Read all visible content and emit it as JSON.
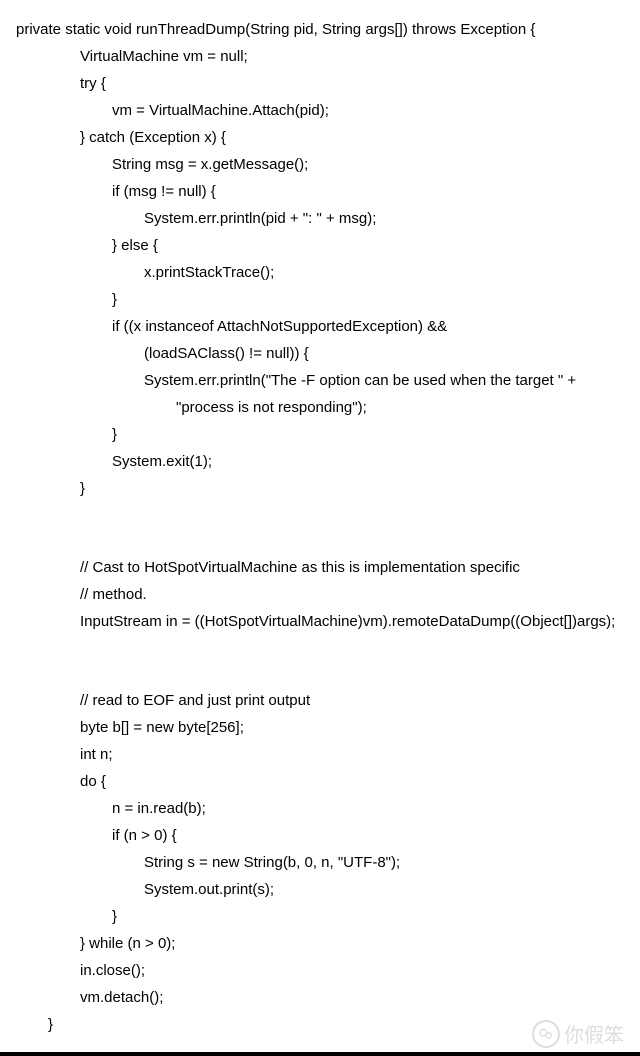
{
  "code": {
    "lines": [
      {
        "indent": 0,
        "text": "private static void runThreadDump(String pid, String args[]) throws Exception {"
      },
      {
        "indent": 2,
        "text": "VirtualMachine vm = null;"
      },
      {
        "indent": 2,
        "text": "try {"
      },
      {
        "indent": 3,
        "text": "vm = VirtualMachine.Attach(pid);"
      },
      {
        "indent": 2,
        "text": "} catch (Exception x) {"
      },
      {
        "indent": 3,
        "text": "String msg = x.getMessage();"
      },
      {
        "indent": 3,
        "text": "if (msg != null) {"
      },
      {
        "indent": 4,
        "text": "System.err.println(pid + \": \" + msg);"
      },
      {
        "indent": 3,
        "text": "} else {"
      },
      {
        "indent": 4,
        "text": "x.printStackTrace();"
      },
      {
        "indent": 3,
        "text": "}"
      },
      {
        "indent": 3,
        "text": "if ((x instanceof AttachNotSupportedException) &&"
      },
      {
        "indent": 4,
        "text": "(loadSAClass() != null)) {"
      },
      {
        "indent": 4,
        "text": "System.err.println(\"The -F option can be used when the target \" +"
      },
      {
        "indent": 5,
        "text": "\"process is not responding\");"
      },
      {
        "indent": 3,
        "text": "}"
      },
      {
        "indent": 3,
        "text": "System.exit(1);"
      },
      {
        "indent": 2,
        "text": "}"
      },
      {
        "indent": 0,
        "text": ""
      },
      {
        "indent": 0,
        "text": ""
      },
      {
        "indent": 2,
        "text": "// Cast to HotSpotVirtualMachine as this is implementation specific"
      },
      {
        "indent": 2,
        "text": "// method."
      },
      {
        "indent": 2,
        "text": "InputStream in = ((HotSpotVirtualMachine)vm).remoteDataDump((Object[])args);"
      },
      {
        "indent": 0,
        "text": ""
      },
      {
        "indent": 0,
        "text": ""
      },
      {
        "indent": 2,
        "text": "// read to EOF and just print output"
      },
      {
        "indent": 2,
        "text": "byte b[] = new byte[256];"
      },
      {
        "indent": 2,
        "text": "int n;"
      },
      {
        "indent": 2,
        "text": "do {"
      },
      {
        "indent": 3,
        "text": "n = in.read(b);"
      },
      {
        "indent": 3,
        "text": "if (n > 0) {"
      },
      {
        "indent": 4,
        "text": "String s = new String(b, 0, n, \"UTF-8\");"
      },
      {
        "indent": 4,
        "text": "System.out.print(s);"
      },
      {
        "indent": 3,
        "text": "}"
      },
      {
        "indent": 2,
        "text": "} while (n > 0);"
      },
      {
        "indent": 2,
        "text": "in.close();"
      },
      {
        "indent": 2,
        "text": "vm.detach();"
      },
      {
        "indent": 1,
        "text": "}"
      }
    ]
  },
  "watermark": {
    "text": "你假笨"
  }
}
